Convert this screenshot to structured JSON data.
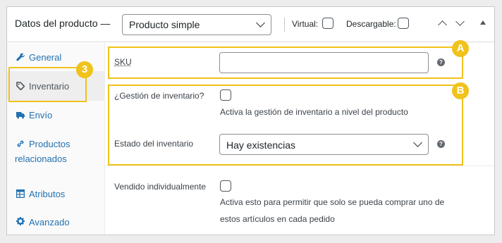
{
  "header": {
    "title": "Datos del producto —",
    "product_type": "Producto simple",
    "virtual_label": "Virtual:",
    "downloadable_label": "Descargable:"
  },
  "tabs": [
    {
      "label": "General",
      "icon": "wrench-icon"
    },
    {
      "label": "Inventario",
      "icon": "tag-icon"
    },
    {
      "label": "Envío",
      "icon": "truck-icon"
    },
    {
      "label": "Productos",
      "label2": "relacionados",
      "icon": "link-icon"
    },
    {
      "label": "Atributos",
      "icon": "table-icon"
    },
    {
      "label": "Avanzado",
      "icon": "gear-icon"
    }
  ],
  "inventory": {
    "sku_label": "SKU",
    "sku_value": "",
    "manage_label": "¿Gestión de inventario?",
    "manage_desc": "Activa la gestión de inventario a nivel del producto",
    "stock_status_label": "Estado del inventario",
    "stock_status_value": "Hay existencias",
    "sold_individually_label": "Vendido individualmente",
    "sold_individually_desc_1": "Activa esto para permitir que solo se pueda comprar uno de",
    "sold_individually_desc_2": "estos artículos en cada pedido"
  },
  "callouts": {
    "a": "A",
    "b": "B",
    "three": "3"
  },
  "colors": {
    "highlight": "#f0c21b",
    "link": "#2271b1"
  }
}
